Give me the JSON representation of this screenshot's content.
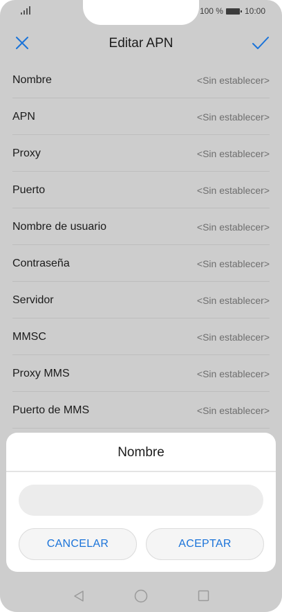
{
  "status_bar": {
    "battery_text": "100 %",
    "time": "10:00",
    "icons": [
      "signal-icon",
      "battery-icon"
    ]
  },
  "header": {
    "title": "Editar APN",
    "icons": [
      "close-icon",
      "check-icon"
    ]
  },
  "fields": [
    {
      "label": "Nombre",
      "value": "<Sin establecer>"
    },
    {
      "label": "APN",
      "value": "<Sin establecer>"
    },
    {
      "label": "Proxy",
      "value": "<Sin establecer>"
    },
    {
      "label": "Puerto",
      "value": "<Sin establecer>"
    },
    {
      "label": "Nombre de usuario",
      "value": "<Sin establecer>"
    },
    {
      "label": "Contraseña",
      "value": "<Sin establecer>"
    },
    {
      "label": "Servidor",
      "value": "<Sin establecer>"
    },
    {
      "label": "MMSC",
      "value": "<Sin establecer>"
    },
    {
      "label": "Proxy MMS",
      "value": "<Sin establecer>"
    },
    {
      "label": "Puerto de MMS",
      "value": "<Sin establecer>"
    }
  ],
  "dialog": {
    "title": "Nombre",
    "input_value": "",
    "cancel_label": "CANCELAR",
    "accept_label": "ACEPTAR"
  },
  "nav_bar": {
    "icons": [
      "back-icon",
      "home-icon",
      "recent-apps-icon"
    ]
  },
  "colors": {
    "accent": "#1a73d9",
    "background": "#cdcdcd",
    "dialog": "#ffffff"
  }
}
